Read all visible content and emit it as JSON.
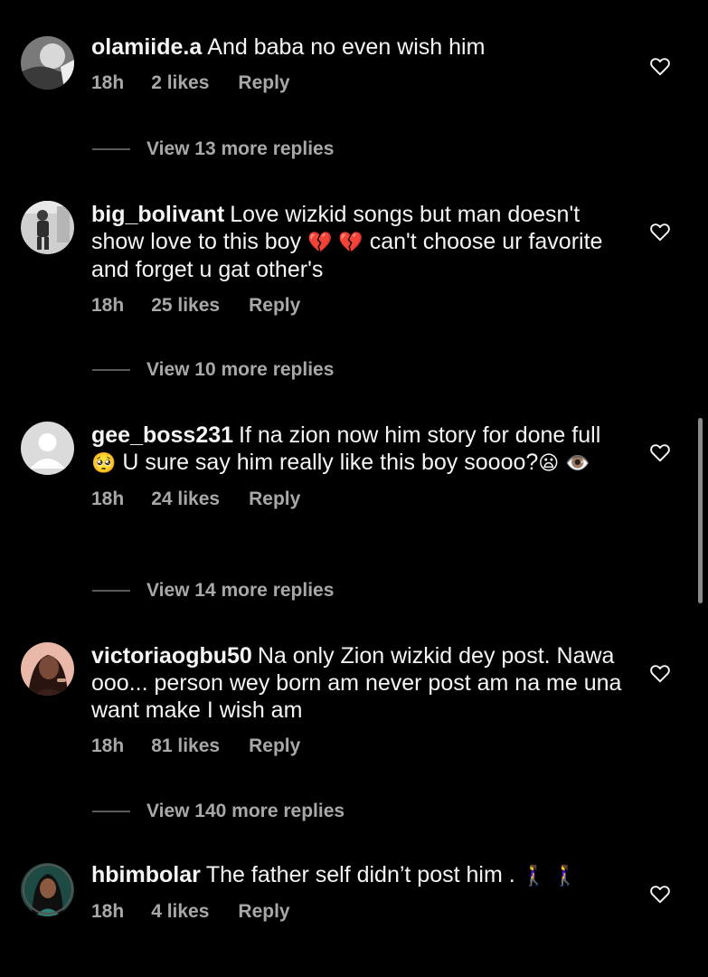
{
  "comments": [
    {
      "username": "olamiide.a",
      "text": "And baba no even wish him",
      "time": "18h",
      "likes": "2 likes",
      "reply": "Reply",
      "view_replies": "View 13 more replies",
      "avatar_icon": "avatar-photo",
      "heart_icon": "heart-outline-icon"
    },
    {
      "username": "big_bolivant",
      "text_parts": [
        "Love wizkid songs but man doesn't show love to this boy ",
        "💔",
        " ",
        "💔",
        "  can't choose ur favorite and forget u gat other's"
      ],
      "time": "18h",
      "likes": "25 likes",
      "reply": "Reply",
      "view_replies": "View 10 more replies",
      "avatar_icon": "avatar-photo",
      "heart_icon": "heart-outline-icon"
    },
    {
      "username": "gee_boss231",
      "text_parts": [
        "If na zion now him story for done full",
        "🥺",
        "  U sure say him really like this boy soooo?",
        "😦",
        " ",
        "👁️"
      ],
      "time": "18h",
      "likes": "24 likes",
      "reply": "Reply",
      "view_replies": "View 14 more replies",
      "avatar_icon": "default-avatar",
      "heart_icon": "heart-outline-icon"
    },
    {
      "username": "victoriaogbu50",
      "text": "Na only Zion wizkid dey post. Nawa ooo... person wey born am never post am na me una want make I wish am",
      "time": "18h",
      "likes": "81 likes",
      "reply": "Reply",
      "view_replies": "View 140 more replies",
      "avatar_icon": "avatar-photo",
      "heart_icon": "heart-outline-icon"
    },
    {
      "username": "hbimbolar",
      "text_parts": [
        "The father self didn’t post him . ",
        "🚶‍♀️",
        " ",
        "🚶‍♀️"
      ],
      "time": "18h",
      "likes": "4 likes",
      "reply": "Reply",
      "avatar_icon": "avatar-photo",
      "heart_icon": "heart-outline-icon"
    }
  ],
  "colors": {
    "background": "#000000",
    "primary_text": "#f5f5f5",
    "secondary_text": "#a8a8a8",
    "divider": "#5a5a5a",
    "scrollbar": "#8a8a8a"
  }
}
